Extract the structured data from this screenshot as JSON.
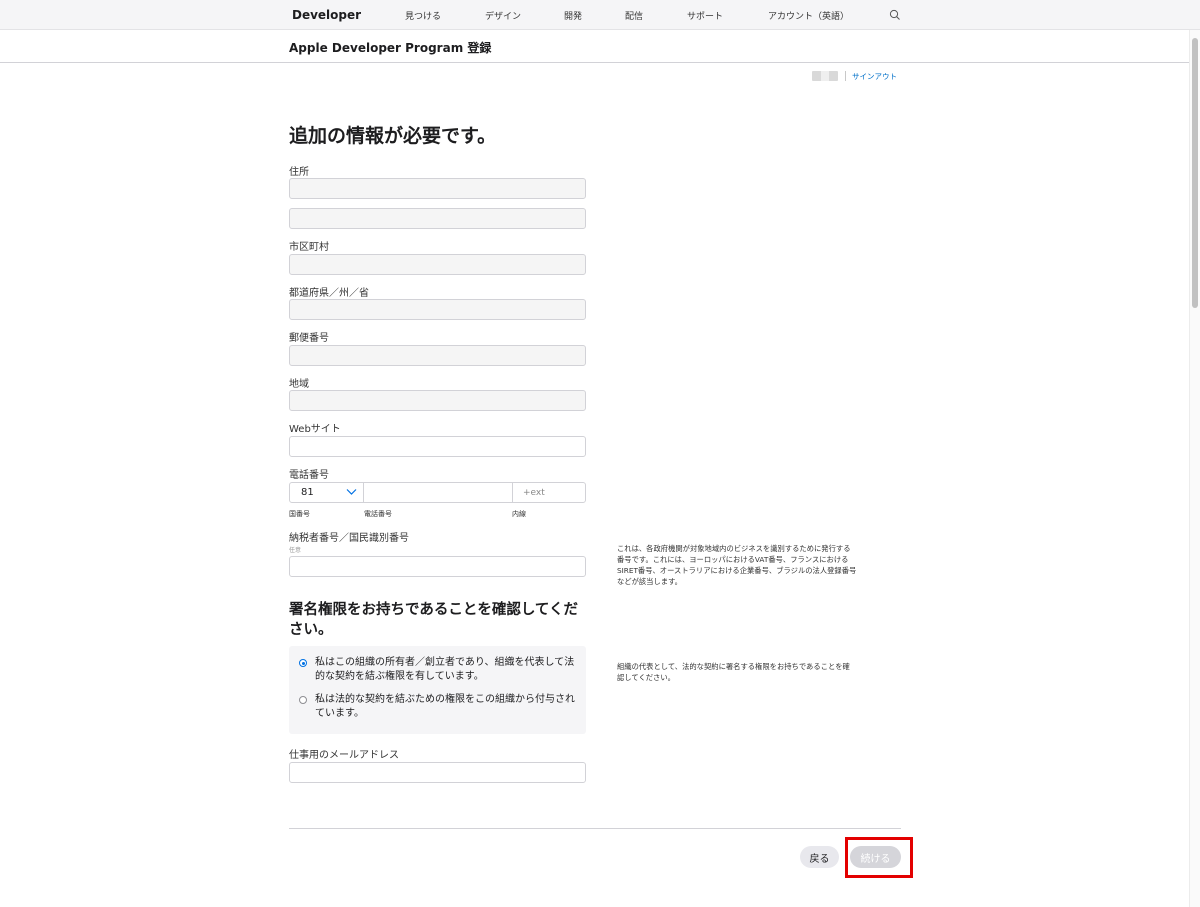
{
  "globalnav": {
    "logo_label": "Developer",
    "items": [
      "見つける",
      "デザイン",
      "開発",
      "配信",
      "サポート",
      "アカウント（英語）"
    ]
  },
  "subnav": {
    "title": "Apple Developer Program 登録"
  },
  "account": {
    "signout_label": "サインアウト"
  },
  "form": {
    "title": "追加の情報が必要です。",
    "address_label": "住所",
    "address_line1": "",
    "address_line2": "",
    "city_label": "市区町村",
    "city": "",
    "state_label": "都道府県／州／省",
    "state": "",
    "postal_label": "郵便番号",
    "postal": "",
    "region_label": "地域",
    "region": "",
    "website_label": "Webサイト",
    "website": "",
    "phone_label": "電話番号",
    "phone_country_code": "81",
    "phone_number": "",
    "phone_ext_placeholder": "+ext",
    "phone_country_sublabel": "国番号",
    "phone_number_sublabel": "電話番号",
    "phone_ext_sublabel": "内線",
    "tax_label": "納税者番号／国民識別番号",
    "tax_optional": "任意",
    "tax_id": "",
    "tax_help": "これは、各政府機関が対象地域内のビジネスを識別するために発行する番号です。これには、ヨーロッパにおけるVAT番号、フランスにおけるSIRET番号、オーストラリアにおける企業番号、ブラジルの法人登録番号などが該当します。",
    "authority_title": "署名権限をお持ちであることを確認してください。",
    "authority_help": "組織の代表として、法的な契約に署名する権限をお持ちであることを確認してください。",
    "authority_options": [
      {
        "label": "私はこの組織の所有者／創立者であり、組織を代表して法的な契約を結ぶ権限を有しています。",
        "selected": true
      },
      {
        "label": "私は法的な契約を結ぶための権限をこの組織から付与されています。",
        "selected": false
      }
    ],
    "work_email_label": "仕事用のメールアドレス",
    "work_email": ""
  },
  "footer": {
    "back_label": "戻る",
    "continue_label": "続ける",
    "continue_disabled": true,
    "highlight_color": "#e30000"
  },
  "colors": {
    "link": "#0070c9",
    "radio_accent": "#0071e3"
  }
}
